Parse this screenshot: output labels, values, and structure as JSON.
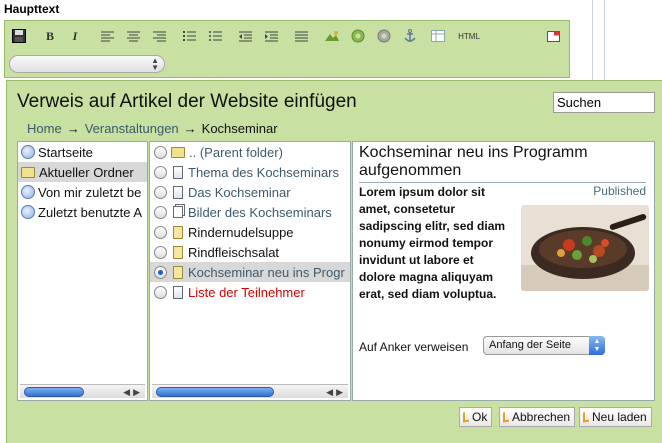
{
  "editor": {
    "label": "Haupttext",
    "html_button": "HTML",
    "bold_button": "B",
    "italic_button": "I"
  },
  "dialog": {
    "title": "Verweis auf Artikel der Website einfügen",
    "search_value": "Suchen",
    "breadcrumb": {
      "items": [
        "Home",
        "Veranstaltungen"
      ],
      "separator": "→",
      "current": "Kochseminar"
    },
    "left_list": [
      {
        "label": "Startseite",
        "icon": "globe-icon"
      },
      {
        "label": "Aktueller Ordner",
        "icon": "folder-icon"
      },
      {
        "label": "Von mir zuletzt be",
        "icon": "history-icon"
      },
      {
        "label": "Zuletzt benutzte A",
        "icon": "history-icon"
      }
    ],
    "mid_list": [
      {
        "label": ".. (Parent folder)",
        "icon": "folder-icon"
      },
      {
        "label": "Thema des Kochseminars",
        "icon": "page-icon"
      },
      {
        "label": "Das Kochseminar",
        "icon": "page-icon"
      },
      {
        "label": "Bilder des Kochseminars",
        "icon": "pages-icon"
      },
      {
        "label": "Rindernudelsuppe",
        "icon": "note-icon"
      },
      {
        "label": "Rindfleischsalat",
        "icon": "note-icon"
      },
      {
        "label": "Kochseminar neu ins Progr",
        "icon": "note-icon"
      },
      {
        "label": "Liste der Teilnehmer",
        "icon": "page-icon"
      }
    ],
    "preview": {
      "title": "Kochseminar neu ins Programm aufgenommen",
      "status": "Published",
      "text": "Lorem ipsum dolor sit amet, consetetur sadipscing elitr, sed diam nonumy eirmod tempor invidunt ut labore et dolore magna aliquyam erat, sed diam voluptua.",
      "anchor_label": "Auf Anker verweisen",
      "anchor_value": "Anfang der Seite"
    },
    "buttons": {
      "ok": "Ok",
      "cancel": "Abbrechen",
      "reload": "Neu laden"
    }
  },
  "colors": {
    "panel_green": "#c9e0a3",
    "link_blue": "#3d5a6e",
    "alert_red": "#dd0000"
  }
}
